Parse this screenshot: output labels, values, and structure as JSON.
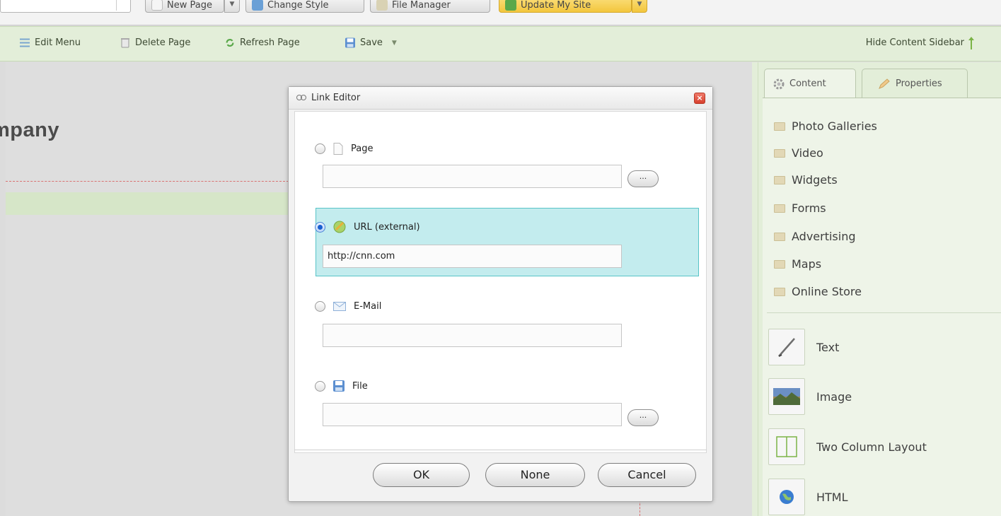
{
  "top_toolbar": {
    "new_page": "New Page",
    "change_style": "Change Style",
    "file_manager": "File Manager",
    "update_site": "Update My Site"
  },
  "edit_toolbar": {
    "edit_menu": "Edit Menu",
    "delete_page": "Delete Page",
    "refresh_page": "Refresh Page",
    "save": "Save",
    "hide_sidebar": "Hide Content Sidebar"
  },
  "page": {
    "heading": "mpany"
  },
  "sidebar": {
    "tabs": [
      {
        "label": "Content",
        "icon": "gear-icon",
        "active": true
      },
      {
        "label": "Properties",
        "icon": "pencil-icon",
        "active": false
      }
    ],
    "folders": [
      {
        "label": "Photo Galleries"
      },
      {
        "label": "Video"
      },
      {
        "label": "Widgets"
      },
      {
        "label": "Forms"
      },
      {
        "label": "Advertising"
      },
      {
        "label": "Maps"
      },
      {
        "label": "Online Store"
      }
    ],
    "blocks": [
      {
        "label": "Text",
        "icon": "pen-icon"
      },
      {
        "label": "Image",
        "icon": "landscape-icon"
      },
      {
        "label": "Two Column Layout",
        "icon": "columns-icon"
      },
      {
        "label": "HTML",
        "icon": "globe-icon"
      }
    ]
  },
  "dialog": {
    "title": "Link Editor",
    "options": [
      {
        "label": "Page",
        "icon": "page-icon",
        "selected": false,
        "value": ""
      },
      {
        "label": "URL (external)",
        "icon": "globe-icon",
        "selected": true,
        "value": "http://cnn.com"
      },
      {
        "label": "E-Mail",
        "icon": "envelope-icon",
        "selected": false,
        "value": ""
      },
      {
        "label": "File",
        "icon": "floppy-icon",
        "selected": false,
        "value": ""
      }
    ],
    "browse_label": "...",
    "buttons": {
      "ok": "OK",
      "none": "None",
      "cancel": "Cancel"
    }
  },
  "colors": {
    "toolbar_green": "#e3eed9",
    "selection_highlight": "#c3ecee",
    "selection_border": "#57c3c7",
    "update_button": "#f3c63c"
  }
}
